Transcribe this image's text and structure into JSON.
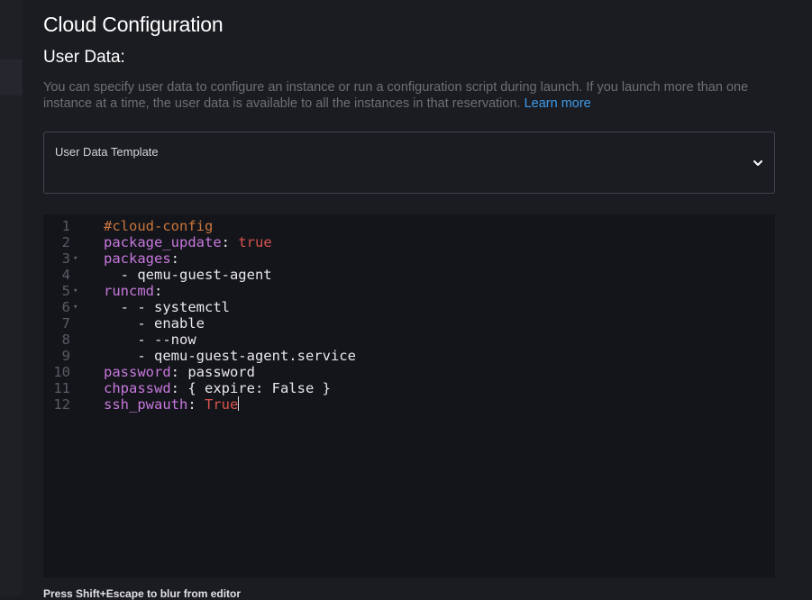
{
  "header": {
    "title": "Cloud Configuration",
    "section": "User Data:"
  },
  "help": {
    "text": "You can specify user data to configure an instance or run a configuration script during launch. If you launch more than one instance at a time, the user data is available to all the instances in that reservation.",
    "link": "Learn more"
  },
  "template_select": {
    "label": "User Data Template",
    "icon": "chevron-down-icon"
  },
  "editor": {
    "lines": [
      {
        "n": "1",
        "fold": false,
        "tokens": [
          {
            "t": "#cloud-config",
            "c": "comment"
          }
        ]
      },
      {
        "n": "2",
        "fold": false,
        "tokens": [
          {
            "t": "package_update",
            "c": "k"
          },
          {
            "t": ": ",
            "c": "v"
          },
          {
            "t": "true",
            "c": "bool"
          }
        ]
      },
      {
        "n": "3",
        "fold": true,
        "tokens": [
          {
            "t": "packages",
            "c": "k"
          },
          {
            "t": ":",
            "c": "v"
          }
        ]
      },
      {
        "n": "4",
        "fold": false,
        "tokens": [
          {
            "t": "  - qemu-guest-agent",
            "c": "v"
          }
        ]
      },
      {
        "n": "5",
        "fold": true,
        "tokens": [
          {
            "t": "runcmd",
            "c": "k"
          },
          {
            "t": ":",
            "c": "v"
          }
        ]
      },
      {
        "n": "6",
        "fold": true,
        "tokens": [
          {
            "t": "  - - systemctl",
            "c": "v"
          }
        ]
      },
      {
        "n": "7",
        "fold": false,
        "tokens": [
          {
            "t": "    - enable",
            "c": "v"
          }
        ]
      },
      {
        "n": "8",
        "fold": false,
        "tokens": [
          {
            "t": "    - --now",
            "c": "v"
          }
        ]
      },
      {
        "n": "9",
        "fold": false,
        "tokens": [
          {
            "t": "    - qemu-guest-agent.service",
            "c": "v"
          }
        ]
      },
      {
        "n": "10",
        "fold": false,
        "tokens": [
          {
            "t": "password",
            "c": "k"
          },
          {
            "t": ": password",
            "c": "v"
          }
        ]
      },
      {
        "n": "11",
        "fold": false,
        "tokens": [
          {
            "t": "chpasswd",
            "c": "k"
          },
          {
            "t": ": { expire: False }",
            "c": "v"
          }
        ]
      },
      {
        "n": "12",
        "fold": false,
        "cursor": true,
        "tokens": [
          {
            "t": "ssh_pwauth",
            "c": "k"
          },
          {
            "t": ": ",
            "c": "v"
          },
          {
            "t": "True",
            "c": "bool"
          }
        ]
      }
    ],
    "fold_icon": "fold-arrow-icon"
  },
  "footer": {
    "hint": "Press Shift+Escape to blur from editor"
  }
}
